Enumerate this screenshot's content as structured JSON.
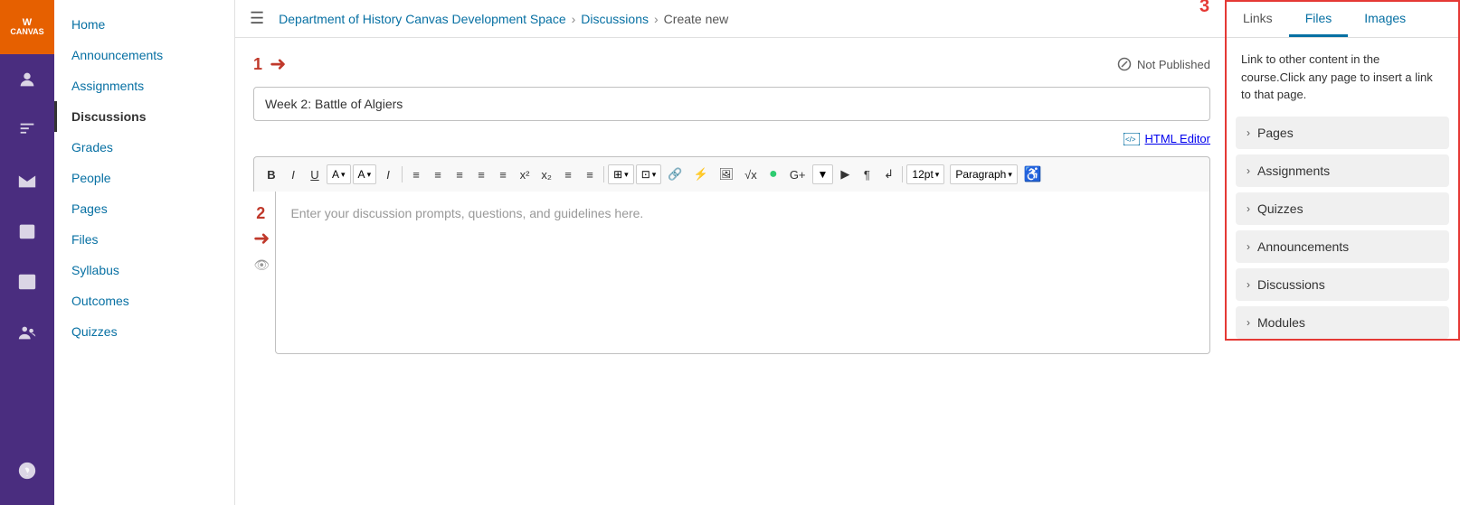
{
  "globalNav": {
    "logo": {
      "line1": "W",
      "line2": "CANVAS"
    },
    "items": [
      {
        "name": "account-icon",
        "label": "Account"
      },
      {
        "name": "bell-icon",
        "label": "Announcements"
      },
      {
        "name": "inbox-icon",
        "label": "Inbox"
      },
      {
        "name": "calendar-icon",
        "label": "Calendar"
      },
      {
        "name": "courses-icon",
        "label": "Courses"
      },
      {
        "name": "groups-icon",
        "label": "Groups"
      },
      {
        "name": "help-icon",
        "label": "Help"
      }
    ]
  },
  "breadcrumb": {
    "course": "Department of History Canvas Development Space",
    "section": "Discussions",
    "page": "Create new",
    "separator": "›"
  },
  "courseNav": {
    "items": [
      {
        "label": "Home",
        "active": false
      },
      {
        "label": "Announcements",
        "active": false
      },
      {
        "label": "Assignments",
        "active": false
      },
      {
        "label": "Discussions",
        "active": true
      },
      {
        "label": "Grades",
        "active": false
      },
      {
        "label": "People",
        "active": false
      },
      {
        "label": "Pages",
        "active": false
      },
      {
        "label": "Files",
        "active": false
      },
      {
        "label": "Syllabus",
        "active": false
      },
      {
        "label": "Outcomes",
        "active": false
      },
      {
        "label": "Quizzes",
        "active": false
      }
    ]
  },
  "editor": {
    "notPublished": "Not Published",
    "titlePlaceholder": "Week 2: Battle of Algiers",
    "htmlEditorLabel": "HTML Editor",
    "bodyPlaceholder": "Enter your discussion prompts, questions, and guidelines here.",
    "annotations": {
      "one": "1",
      "two": "2",
      "three": "3"
    }
  },
  "toolbar": {
    "buttons": [
      "B",
      "I",
      "U",
      "A",
      "A",
      "I",
      "≡",
      "≡",
      "≡",
      "≡",
      "≡",
      "x²",
      "x₂",
      "≡",
      "≡"
    ],
    "row2": [
      "⊞",
      "⊡",
      "🔗",
      "⚡",
      "🖼",
      "√",
      "●",
      "G+",
      "▼",
      "▶",
      "¶",
      "↲"
    ],
    "fontSize": "12pt",
    "paragraph": "Paragraph"
  },
  "rightPanel": {
    "tabs": [
      "Links",
      "Files",
      "Images"
    ],
    "activeTab": "Links",
    "description": "Link to other content in the course.Click any page to insert a link to that page.",
    "links": [
      {
        "label": "Pages"
      },
      {
        "label": "Assignments"
      },
      {
        "label": "Quizzes"
      },
      {
        "label": "Announcements"
      },
      {
        "label": "Discussions"
      },
      {
        "label": "Modules"
      }
    ]
  }
}
